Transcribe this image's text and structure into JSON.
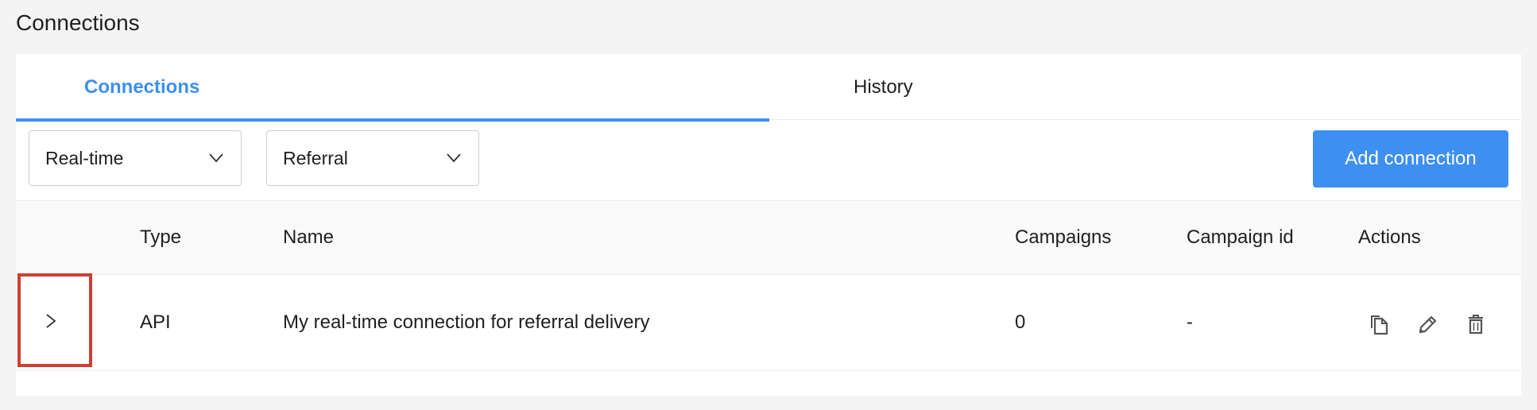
{
  "page": {
    "title": "Connections"
  },
  "tabs": [
    {
      "label": "Connections",
      "active": true
    },
    {
      "label": "History",
      "active": false
    }
  ],
  "filters": {
    "type_value": "Real-time",
    "kind_value": "Referral"
  },
  "toolbar": {
    "add_label": "Add connection"
  },
  "table": {
    "columns": [
      "Type",
      "Name",
      "Campaigns",
      "Campaign id",
      "Actions"
    ],
    "rows": [
      {
        "type": "API",
        "name": "My real-time connection for referral delivery",
        "campaigns": "0",
        "campaign_id": "-"
      }
    ]
  },
  "icons": {
    "expand": "chevron-right-icon",
    "dropdown": "chevron-down-icon",
    "copy": "copy-icon",
    "edit": "pencil-icon",
    "delete": "trash-icon"
  },
  "colors": {
    "accent": "#3d8ff2",
    "highlight": "#cd3f33",
    "background": "#f4f4f4"
  }
}
